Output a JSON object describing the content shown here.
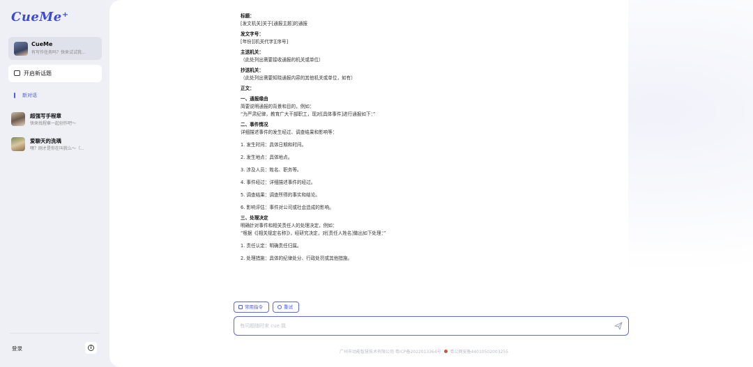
{
  "sidebar": {
    "logo": "CueMe⁺",
    "cueme_card": {
      "title": "CueMe",
      "subtitle": "有写作任务吗？快来试试我..."
    },
    "new_topic_label": "开启新话题",
    "active_chat_label": "新对话",
    "assistants": [
      {
        "name": "超强写手程章",
        "desc": "快来找程章一起创作吧～"
      },
      {
        "name": "爱聊天的洗瑀",
        "desc": "嘿？刚才是你在叫我么～（..."
      }
    ],
    "login_label": "登录",
    "info_icon": "info-icon"
  },
  "document": {
    "lines": [
      {
        "t": "标题：",
        "style": "h"
      },
      {
        "t": "[发文机关]关于[通报主题]的通报",
        "style": "n"
      },
      {
        "t": "发文字号：",
        "style": "h"
      },
      {
        "t": "[年份][机关代字][序号]",
        "style": "n"
      },
      {
        "t": "主送机关：",
        "style": "h"
      },
      {
        "t": "（此处列出需要接收通报的机关或单位）",
        "style": "n"
      },
      {
        "t": "抄送机关：",
        "style": "h"
      },
      {
        "t": "（此处列出需要知晓通报内容的其他机关或单位，如有）",
        "style": "n"
      },
      {
        "t": "正文：",
        "style": "h"
      },
      {
        "t": "一、通报缘由",
        "style": "h"
      },
      {
        "t": "简要说明通报的背景和目的，例如：",
        "style": "n"
      },
      {
        "t": "“为严肃纪律，教育广大干部职工，现对[具体事件]进行通报如下：”",
        "style": "n"
      },
      {
        "t": "二、事件情况",
        "style": "h"
      },
      {
        "t": "详细描述事件的发生经过、调查结果和影响等：",
        "style": "n"
      },
      {
        "t": "1. 发生时间：具体日期和时间。",
        "style": "li"
      },
      {
        "t": "2. 发生地点：具体地点。",
        "style": "li"
      },
      {
        "t": "3. 涉及人员：姓名、职务等。",
        "style": "li"
      },
      {
        "t": "4. 事件经过：详细描述事件的经过。",
        "style": "li"
      },
      {
        "t": "5. 调查结果：调查所得的事实和结论。",
        "style": "li"
      },
      {
        "t": "6. 影响评估：事件对公司或社会造成的影响。",
        "style": "li"
      },
      {
        "t": "三、处理决定",
        "style": "h"
      },
      {
        "t": "明确针对事件和相关责任人的处理决定，例如：",
        "style": "n"
      },
      {
        "t": "“根据《[相关规定名称]》，经研究决定，对[责任人姓名]做出如下处理：”",
        "style": "n"
      },
      {
        "t": "1. 责任认定：明确责任归属。",
        "style": "li"
      },
      {
        "t": "2. 处理措施：具体的纪律处分、行政处罚或其他措施。",
        "style": "li"
      }
    ]
  },
  "toolbar": {
    "common_commands_label": "常用指令",
    "retry_label": "重试"
  },
  "input": {
    "placeholder": "有问题随时来 cue 我"
  },
  "footer": {
    "company": "广州市动能智慧技术有限公司 粤ICP备2022013364号",
    "police": "粤公网安备44010502003255"
  }
}
